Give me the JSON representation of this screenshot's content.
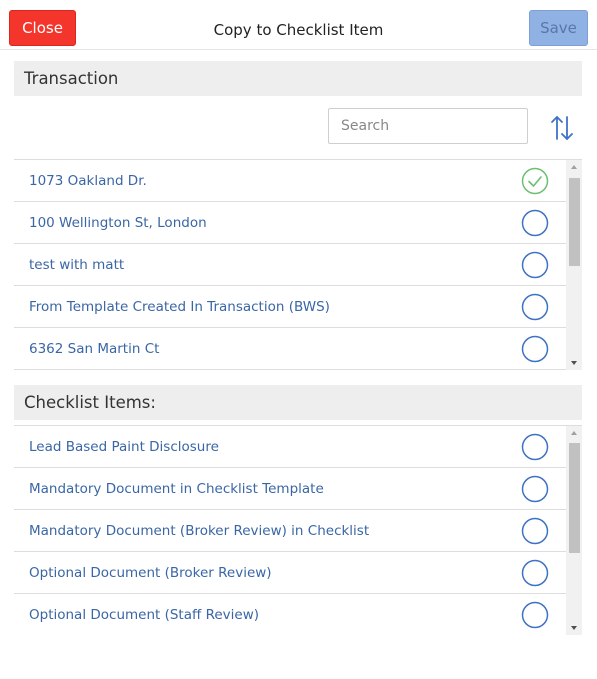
{
  "header": {
    "close_label": "Close",
    "title": "Copy to Checklist Item",
    "save_label": "Save"
  },
  "transaction": {
    "heading": "Transaction",
    "search_placeholder": "Search",
    "items": [
      {
        "label": "1073 Oakland Dr.",
        "selected": true
      },
      {
        "label": "100 Wellington St, London",
        "selected": false
      },
      {
        "label": "test with matt",
        "selected": false
      },
      {
        "label": "From Template Created In Transaction (BWS)",
        "selected": false
      },
      {
        "label": "6362 San Martin Ct",
        "selected": false
      }
    ]
  },
  "checklist": {
    "heading": "Checklist Items:",
    "items": [
      {
        "label": "Lead Based Paint Disclosure",
        "selected": false
      },
      {
        "label": "Mandatory Document in Checklist Template",
        "selected": false
      },
      {
        "label": "Mandatory Document (Broker Review) in Checklist",
        "selected": false
      },
      {
        "label": "Optional Document (Broker Review)",
        "selected": false
      },
      {
        "label": "Optional Document (Staff Review)",
        "selected": false
      }
    ]
  },
  "colors": {
    "close": "#f4352b",
    "save": "#8fb1e3",
    "link": "#3a66a6",
    "radio_ring": "#3f72c4",
    "check": "#6cc070"
  },
  "icons": {
    "sort": "sort-arrows-icon",
    "check": "check-circle-icon",
    "radio": "radio-empty-icon"
  }
}
